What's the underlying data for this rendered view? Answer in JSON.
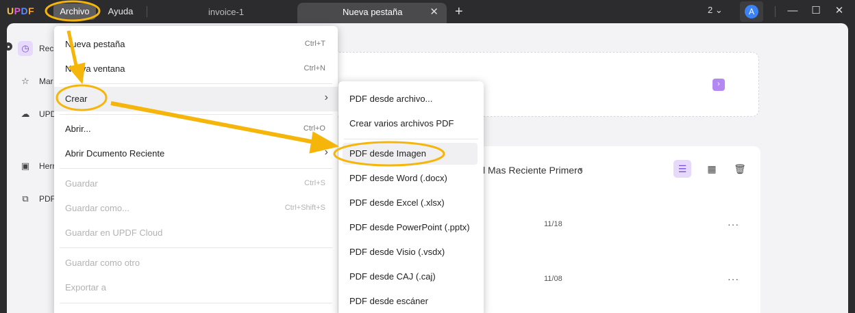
{
  "app": {
    "logo": "UPDF",
    "menu": {
      "archivo": "Archivo",
      "ayuda": "Ayuda"
    },
    "tabs": [
      {
        "label": "invoice-1",
        "active": false
      },
      {
        "label": "Nueva pestaña",
        "active": true
      }
    ],
    "window_count": "2",
    "avatar_letter": "A",
    "accent_color": "#f5b50b"
  },
  "sidebar": {
    "items": [
      {
        "label": "Reci",
        "icon": "clock-icon"
      },
      {
        "label": "Mar",
        "icon": "star-icon"
      },
      {
        "label": "UPD",
        "icon": "cloud-icon"
      },
      {
        "label": "Herr",
        "icon": "toolbox-icon"
      },
      {
        "label": "PDF",
        "icon": "copy-icon"
      }
    ]
  },
  "content": {
    "sort_label": "l Mas Reciente Primero",
    "rows": [
      {
        "date": "11/18"
      },
      {
        "date": "11/08"
      }
    ]
  },
  "file_menu": {
    "items": [
      {
        "label": "Nueva pestaña",
        "shortcut": "Ctrl+T"
      },
      {
        "label": "Nueva ventana",
        "shortcut": "Ctrl+N"
      },
      {
        "label": "Crear"
      },
      {
        "label": "Abrir...",
        "shortcut": "Ctrl+O"
      },
      {
        "label": "Abrir Dcumento Reciente"
      },
      {
        "label": "Guardar",
        "shortcut": "Ctrl+S"
      },
      {
        "label": "Guardar como...",
        "shortcut": "Ctrl+Shift+S"
      },
      {
        "label": "Guardar en UPDF Cloud"
      },
      {
        "label": "Guardar como otro"
      },
      {
        "label": "Exportar a"
      }
    ]
  },
  "create_submenu": {
    "items": [
      {
        "label": "PDF desde archivo..."
      },
      {
        "label": "Crear varios archivos PDF"
      },
      {
        "label": "PDF desde Imagen"
      },
      {
        "label": "PDF desde Word (.docx)"
      },
      {
        "label": "PDF desde Excel (.xlsx)"
      },
      {
        "label": "PDF desde PowerPoint (.pptx)"
      },
      {
        "label": "PDF desde Visio (.vsdx)"
      },
      {
        "label": "PDF desde CAJ (.caj)"
      },
      {
        "label": "PDF desde escáner"
      }
    ]
  }
}
